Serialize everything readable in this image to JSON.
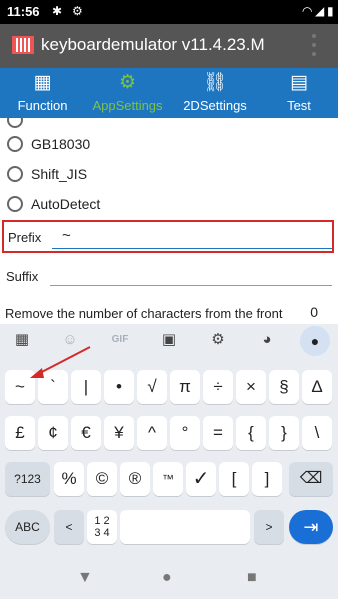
{
  "status_bar": {
    "time": "11:56",
    "left_icons": [
      "gear-icon",
      "settings-sync-icon"
    ],
    "right_icons": [
      "wifi-icon",
      "signal-icon",
      "battery-icon"
    ]
  },
  "app_bar": {
    "title": "keyboardemulator v11.4.23.M"
  },
  "tabs": [
    {
      "label": "Function",
      "icon": "grid-icon",
      "active": false
    },
    {
      "label": "AppSettings",
      "icon": "gear-icon",
      "active": true
    },
    {
      "label": "2DSettings",
      "icon": "link-icon",
      "active": false
    },
    {
      "label": "Test",
      "icon": "calculator-icon",
      "active": false
    }
  ],
  "settings": {
    "encodings": [
      "GB18030",
      "Shift_JIS",
      "AutoDetect"
    ],
    "prefix_label": "Prefix",
    "prefix_value": "~",
    "suffix_label": "Suffix",
    "suffix_value": "",
    "remove_front_label": "Remove the number of characters from the front",
    "remove_front_value": "0"
  },
  "keyboard": {
    "toolbar": [
      "apps-icon",
      "sticker-icon",
      "GIF",
      "clipboard-icon",
      "settings-icon",
      "palette-icon",
      "mic-icon"
    ],
    "row1": [
      "~",
      "`",
      "|",
      "•",
      "√",
      "π",
      "÷",
      "×",
      "§",
      "Δ"
    ],
    "row2": [
      "£",
      "¢",
      "€",
      "¥",
      "^",
      "°",
      "=",
      "{",
      "}",
      "\\"
    ],
    "row3": [
      "?123",
      "%",
      "©",
      "®",
      "™",
      "✓",
      "[",
      "]",
      "backspace"
    ],
    "row4": [
      "ABC",
      "<",
      "1 2\n3 4",
      "",
      ">",
      "enter"
    ]
  },
  "colors": {
    "tab_bar": "#1e76c0",
    "active_tab": "#7dc242",
    "highlight_border": "#d42929",
    "enter_key": "#1a6fd6"
  }
}
